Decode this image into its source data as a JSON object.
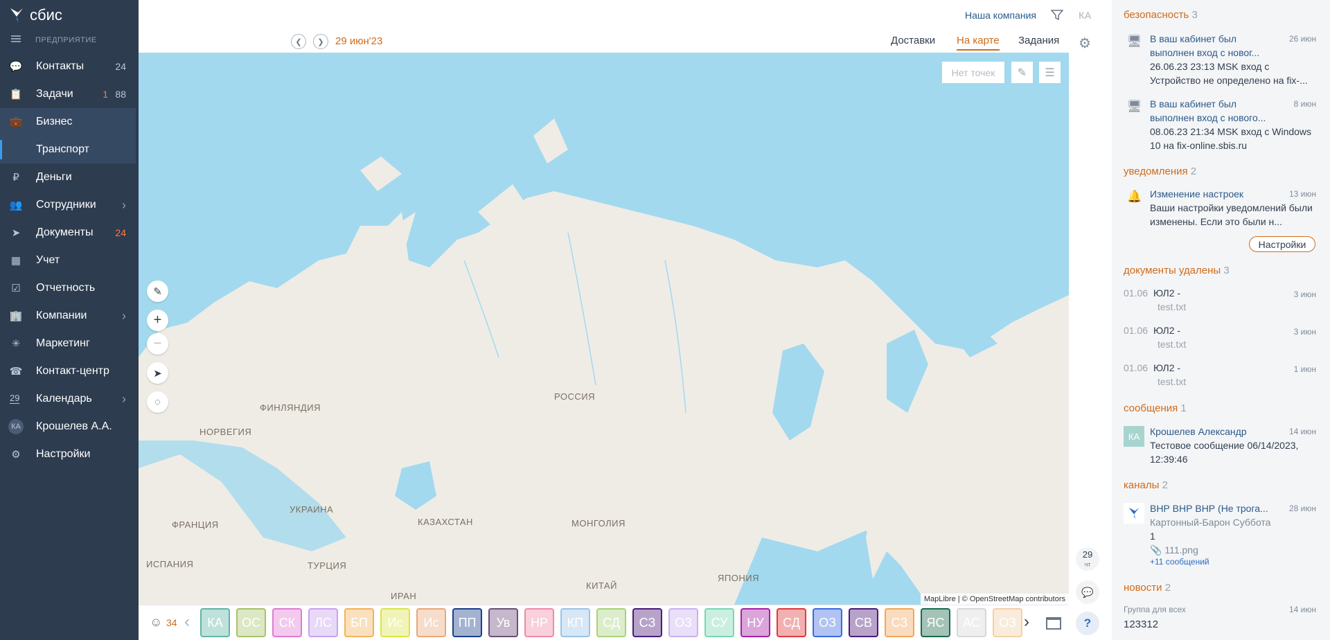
{
  "app": {
    "logo_text": "сбис",
    "org_label": "ПРЕДПРИЯТИЕ"
  },
  "sidebar": {
    "items": [
      {
        "label": "Контакты",
        "count": "24",
        "icon": "chat-bubbles-icon"
      },
      {
        "label": "Задачи",
        "count_red": "1",
        "count": "88",
        "icon": "clipboard-icon"
      },
      {
        "label": "Бизнес",
        "icon": "briefcase-icon"
      },
      {
        "label": "Транспорт"
      },
      {
        "label": "Деньги",
        "icon": "ruble-icon"
      },
      {
        "label": "Сотрудники",
        "icon": "people-icon"
      },
      {
        "label": "Документы",
        "count_red": "24",
        "icon": "paper-plane-icon"
      },
      {
        "label": "Учет",
        "icon": "calculator-icon"
      },
      {
        "label": "Отчетность",
        "icon": "report-icon"
      },
      {
        "label": "Компании",
        "icon": "company-icon"
      },
      {
        "label": "Маркетинг",
        "icon": "sparkle-icon"
      },
      {
        "label": "Контакт-центр",
        "icon": "headset-icon"
      },
      {
        "label": "Календарь",
        "day": "29",
        "icon": "calendar-icon"
      },
      {
        "label": "Крошелев А.А.",
        "avatar": "КА"
      },
      {
        "label": "Настройки",
        "icon": "gear-icon"
      }
    ]
  },
  "header": {
    "company": "Наша компания",
    "user_initials": "КА",
    "date": "29 июн'23",
    "tabs": [
      "Доставки",
      "На карте",
      "Задания"
    ],
    "active_tab": "На карте"
  },
  "map": {
    "no_points": "Нет точек",
    "attribution": "MapLibre | © OpenStreetMap contributors",
    "labels": {
      "russia": "РОССИЯ",
      "finland": "ФИНЛЯНДИЯ",
      "norway": "НОРВЕГИЯ",
      "ukraine": "УКРАИНА",
      "france": "ФРАНЦИЯ",
      "kazakhstan": "КАЗАХСТАН",
      "mongolia": "МОНГОЛИЯ",
      "spain": "ИСПАНИЯ",
      "turkey": "ТУРЦИЯ",
      "iran": "ИРАН",
      "china": "КИТАЙ",
      "japan": "ЯПОНИЯ"
    },
    "colors": {
      "water": "#a2d9ef",
      "land": "#efece6"
    }
  },
  "bottom": {
    "count": "34",
    "chips": [
      {
        "label": "КА",
        "color": "#5fb5a8"
      },
      {
        "label": "ОС",
        "color": "#a8c26a"
      },
      {
        "label": "СК",
        "color": "#e07ad2"
      },
      {
        "label": "ЛС",
        "color": "#c9a0f0"
      },
      {
        "label": "БП",
        "color": "#f3b25a"
      },
      {
        "label": "Ис",
        "color": "#dce44a"
      },
      {
        "label": "Ис",
        "color": "#e9a87a"
      },
      {
        "label": "ПП",
        "color": "#1a3f8a"
      },
      {
        "label": "Ув",
        "color": "#6b4e7a"
      },
      {
        "label": "НР",
        "color": "#f08aa6"
      },
      {
        "label": "КП",
        "color": "#9ac3e6"
      },
      {
        "label": "СД",
        "color": "#a8d27a"
      },
      {
        "label": "СЗ",
        "color": "#4a1a7a"
      },
      {
        "label": "ОЗ",
        "color": "#c9b0f0"
      },
      {
        "label": "СУ",
        "color": "#7ad6b5"
      },
      {
        "label": "НУ",
        "color": "#a61ea6"
      },
      {
        "label": "СД",
        "color": "#e03a3a"
      },
      {
        "label": "ОЗ",
        "color": "#3a6ae0"
      },
      {
        "label": "СВ",
        "color": "#4a1a7a"
      },
      {
        "label": "СЗ",
        "color": "#f2a65a"
      },
      {
        "label": "ЯС",
        "color": "#1a6a4a"
      },
      {
        "label": "АС",
        "color": "#d6d6d6"
      },
      {
        "label": "ОЗ",
        "color": "#f3d0a6"
      }
    ]
  },
  "rail": {
    "day": "29",
    "weekday": "чт",
    "help": "?"
  },
  "feed": {
    "security": {
      "title": "безопасность",
      "count": "3",
      "items": [
        {
          "title": "В ваш кабинет был выполнен вход с новог...",
          "time": "26 июн",
          "body": "26.06.23 23:13 MSK вход с Устройство не определено на fix-..."
        },
        {
          "title": "В ваш кабинет был выполнен вход с нового...",
          "time": "8 июн",
          "body": "08.06.23 21:34 MSK вход с Windows 10 на fix-online.sbis.ru"
        }
      ]
    },
    "notifications": {
      "title": "уведомления",
      "count": "2",
      "item": {
        "title": "Изменение настроек",
        "time": "13 июн",
        "body": "Ваши настройки уведомлений были изменены. Если это были н...",
        "button": "Настройки"
      }
    },
    "docs": {
      "title": "документы удалены",
      "count": "3",
      "items": [
        {
          "date": "01.06",
          "name": "ЮЛ2 -",
          "file": "test.txt",
          "time": "3 июн"
        },
        {
          "date": "01.06",
          "name": "ЮЛ2 -",
          "file": "test.txt",
          "time": "3 июн"
        },
        {
          "date": "01.06",
          "name": "ЮЛ2 -",
          "file": "test.txt",
          "time": "1 июн"
        }
      ]
    },
    "messages": {
      "title": "сообщения",
      "count": "1",
      "item": {
        "avatar": "КА",
        "title": "Крошелев Александр",
        "time": "14 июн",
        "body": "Тестовое сообщение 06/14/2023, 12:39:46"
      }
    },
    "channels": {
      "title": "каналы",
      "count": "2",
      "item": {
        "title": "ВНР ВНР ВНР (Не трога...",
        "time": "28 июн",
        "author": "Картонный-Барон Суббота",
        "text": "1",
        "file": "111.png",
        "more": "+11 сообщений"
      }
    },
    "news": {
      "title": "новости",
      "count": "2",
      "item": {
        "group": "Группа для всех",
        "time": "14 июн",
        "text": "123312"
      }
    }
  }
}
